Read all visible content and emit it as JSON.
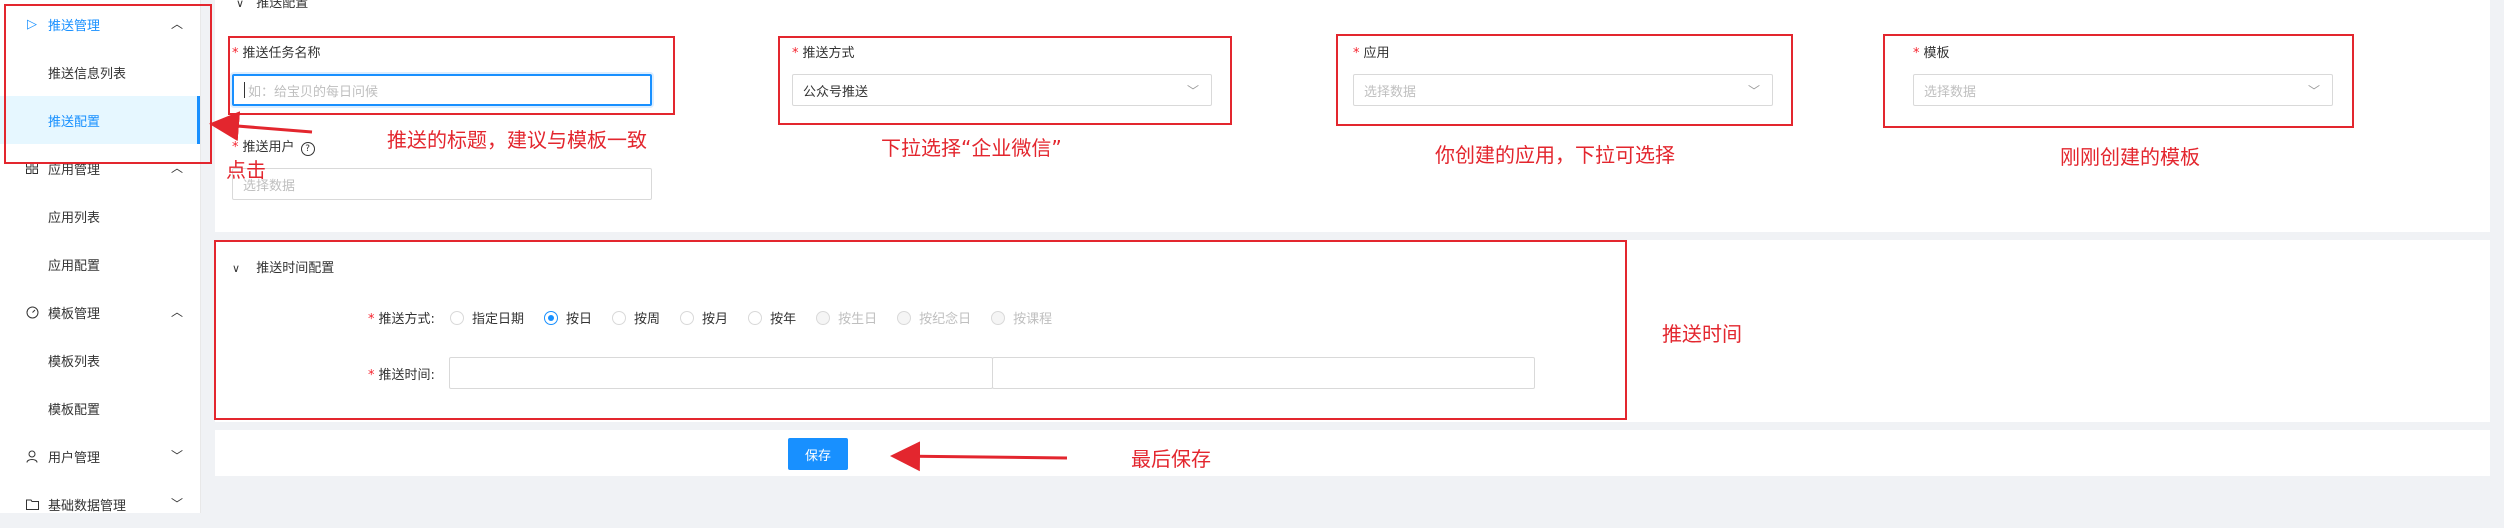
{
  "sidebar": {
    "groups": [
      {
        "icon": "send-icon",
        "label": "推送管理",
        "items": [
          "推送信息列表",
          "推送配置"
        ]
      },
      {
        "icon": "grid-icon",
        "label": "应用管理",
        "items": [
          "应用列表",
          "应用配置"
        ]
      },
      {
        "icon": "dashboard-icon",
        "label": "模板管理",
        "items": [
          "模板列表",
          "模板配置"
        ]
      },
      {
        "icon": "user-icon",
        "label": "用户管理"
      },
      {
        "icon": "folder-icon",
        "label": "基础数据管理"
      }
    ]
  },
  "header": {
    "section_title": "推送配置"
  },
  "form": {
    "task_name": {
      "label": "推送任务名称",
      "placeholder": "如：给宝贝的每日问候"
    },
    "push_method": {
      "label": "推送方式",
      "value": "公众号推送"
    },
    "app": {
      "label": "应用",
      "placeholder": "选择数据"
    },
    "template": {
      "label": "模板",
      "placeholder": "选择数据"
    },
    "push_user": {
      "label": "推送用户",
      "placeholder": "选择数据"
    }
  },
  "time_config": {
    "title": "推送时间配置",
    "method_label": "推送方式:",
    "options": [
      {
        "label": "指定日期",
        "state": "normal"
      },
      {
        "label": "按日",
        "state": "checked"
      },
      {
        "label": "按周",
        "state": "normal"
      },
      {
        "label": "按月",
        "state": "normal"
      },
      {
        "label": "按年",
        "state": "normal"
      },
      {
        "label": "按生日",
        "state": "disabled"
      },
      {
        "label": "按纪念日",
        "state": "disabled"
      },
      {
        "label": "按课程",
        "state": "disabled"
      }
    ],
    "time_label": "推送时间:"
  },
  "save_label": "保存",
  "annotations": {
    "title_tip": "推送的标题，建议与模板一致",
    "click_tip": "点击",
    "method_tip": "下拉选择“企业微信”",
    "app_tip": "你创建的应用，下拉可选择",
    "template_tip": "刚刚创建的模板",
    "time_tip": "推送时间",
    "save_tip": "最后保存"
  },
  "colors": {
    "primary": "#1890ff",
    "annotation": "#e3262e",
    "required": "#f5222d"
  }
}
